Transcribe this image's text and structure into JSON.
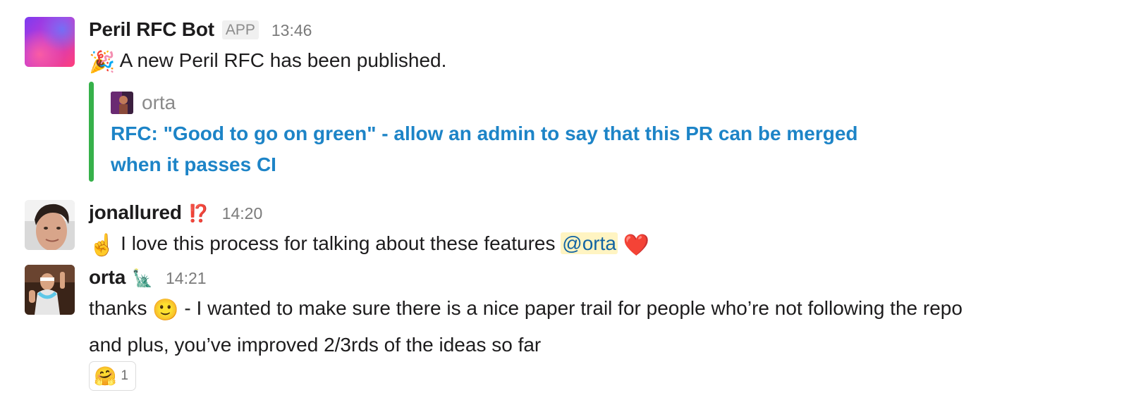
{
  "messages": [
    {
      "sender": "Peril RFC Bot",
      "badge": "APP",
      "time": "13:46",
      "emoji": "🎉",
      "text": "A new Peril RFC has been published.",
      "attachment": {
        "author": "orta",
        "title": "RFC: \"Good to go on green\" - allow an admin to say that this PR can be merged when it passes CI",
        "bar_color": "#36b14a"
      }
    },
    {
      "sender": "jonallured",
      "status_emoji": "⁉️",
      "time": "14:20",
      "leading_emoji": "☝️",
      "text": "I love this process for talking about these features",
      "mention": "@orta",
      "trailing_emoji": "❤️"
    },
    {
      "sender": "orta",
      "status_emoji": "🗽",
      "time": "14:21",
      "text_before_emoji": "thanks",
      "inline_emoji": "🙂",
      "text_after_emoji": "- I wanted to make sure there is a nice paper trail for people who’re not following the repo",
      "second_line": "and plus, you’ve improved 2/3rds of the ideas so far",
      "reaction": {
        "emoji": "🤗",
        "count": "1"
      }
    }
  ]
}
